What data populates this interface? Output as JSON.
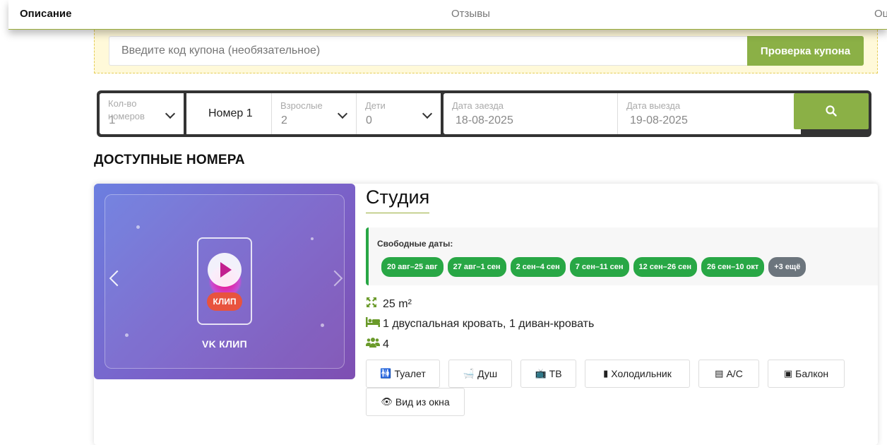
{
  "tabs": {
    "description": "Описание",
    "reviews": "Отзывы",
    "cut": "Оц"
  },
  "coupon": {
    "placeholder": "Введите код купона (необязательное)",
    "button": "Проверка купона"
  },
  "search": {
    "rooms_label": "Кол-во номеров",
    "rooms_value": "1",
    "room_label": "Номер 1",
    "adults_label": "Взрослые",
    "adults_value": "2",
    "kids_label": "Дети",
    "kids_value": "0",
    "checkin_label": "Дата заезда",
    "checkin_value": "18-08-2025",
    "checkout_label": "Дата выезда",
    "checkout_value": "19-08-2025"
  },
  "heading": "ДОСТУПНЫЕ НОМЕРА",
  "room": {
    "media_caption": "VK КЛИП",
    "clip_badge": "КЛИП",
    "title": "Студия",
    "availability_title": "Свободные даты:",
    "dates": [
      "20 авг–25 авг",
      "27 авг–1 сен",
      "2 сен–4 сен",
      "7 сен–11 сен",
      "12 сен–26 сен",
      "26 сен–10 окт"
    ],
    "more_dates": "+3 ещё",
    "area": "25 m²",
    "beds": "1 двуспальная кровать, 1 диван-кровать",
    "guests": "4",
    "amenities": [
      "Туалет",
      "Душ",
      "ТВ",
      "Холодильник",
      "A/C",
      "Балкон",
      "Вид из окна"
    ]
  },
  "colors": {
    "accent_green": "#8bb046",
    "available_green": "#28a745",
    "more_gray": "#6c757d",
    "search_bg": "#333333"
  }
}
